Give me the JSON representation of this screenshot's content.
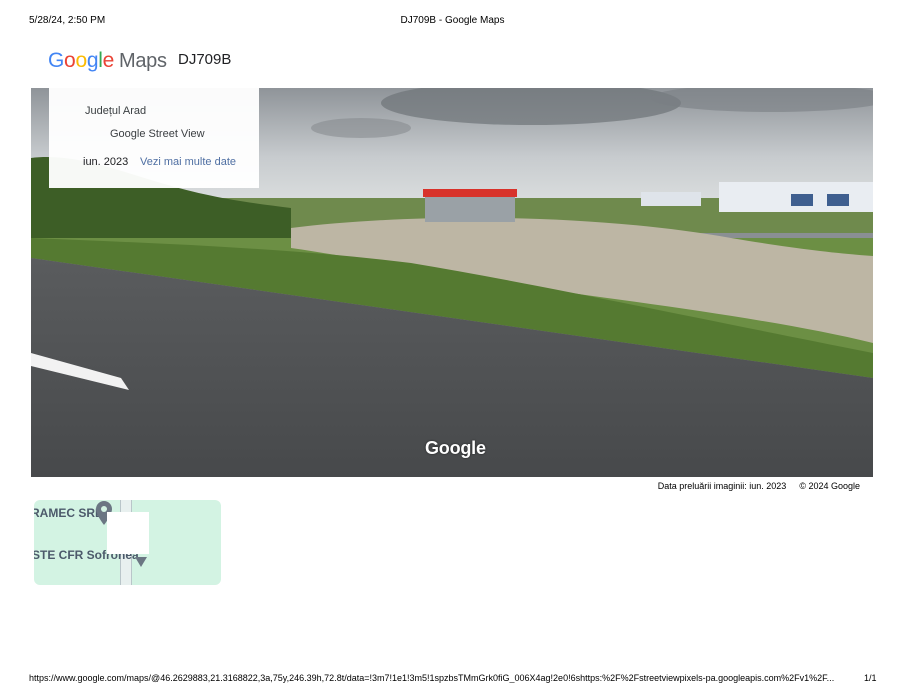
{
  "print_header": {
    "datetime": "5/28/24, 2:50 PM",
    "title": "DJ709B - Google Maps"
  },
  "brand": {
    "google": "Google",
    "maps": "Maps",
    "place_name": "DJ709B"
  },
  "info_card": {
    "county": "Județul Arad",
    "source": "Google Street View",
    "date": "iun. 2023",
    "more_dates": "Vezi mai multe date"
  },
  "streetview": {
    "watermark": "Google",
    "road_watermark": "© 2024 Google"
  },
  "caption": {
    "capture_date": "Data preluării imaginii: iun. 2023",
    "copyright": "© 2024 Google"
  },
  "minimap": {
    "label_top": "RAMEC SRL",
    "label_bottom": "STE CFR Sofronea"
  },
  "print_footer": {
    "url": "https://www.google.com/maps/@46.2629883,21.3168822,3a,75y,246.39h,72.8t/data=!3m7!1e1!3m5!1spzbsTMmGrk0fiG_006X4ag!2e0!6shttps:%2F%2Fstreetviewpixels-pa.googleapis.com%2Fv1%2F...",
    "page": "1/1"
  },
  "colors": {
    "google_blue": "#4285F4",
    "google_red": "#EA4335",
    "google_yellow": "#FBBC05",
    "google_green": "#34A853",
    "link": "#4f6fa3",
    "minimap_bg": "#d3f3e3"
  }
}
